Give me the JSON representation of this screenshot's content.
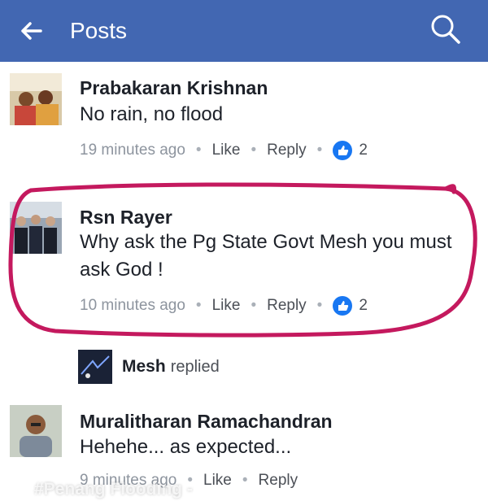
{
  "header": {
    "title": "Posts",
    "accent_color": "#4267b2",
    "back_icon": "arrow-left-icon",
    "search_icon": "search-icon"
  },
  "comments": [
    {
      "author": "Prabakaran Krishnan",
      "text": "No rain, no flood",
      "time": "19 minutes ago",
      "like_label": "Like",
      "reply_label": "Reply",
      "like_count": "2"
    },
    {
      "author": "Rsn Rayer",
      "text": "Why ask the Pg State Govt Mesh you must ask God !",
      "time": "10 minutes ago",
      "like_label": "Like",
      "reply_label": "Reply",
      "like_count": "2"
    },
    {
      "author": "Muralitharan Ramachandran",
      "text": "Hehehe... as expected...",
      "time": "9 minutes ago",
      "like_label": "Like",
      "reply_label": "Reply"
    }
  ],
  "reply_summary": {
    "name": "Mesh",
    "action": "replied"
  },
  "meta_separator": "•",
  "watermark": "#Penang Flooding -",
  "highlight_color": "#c4195e"
}
